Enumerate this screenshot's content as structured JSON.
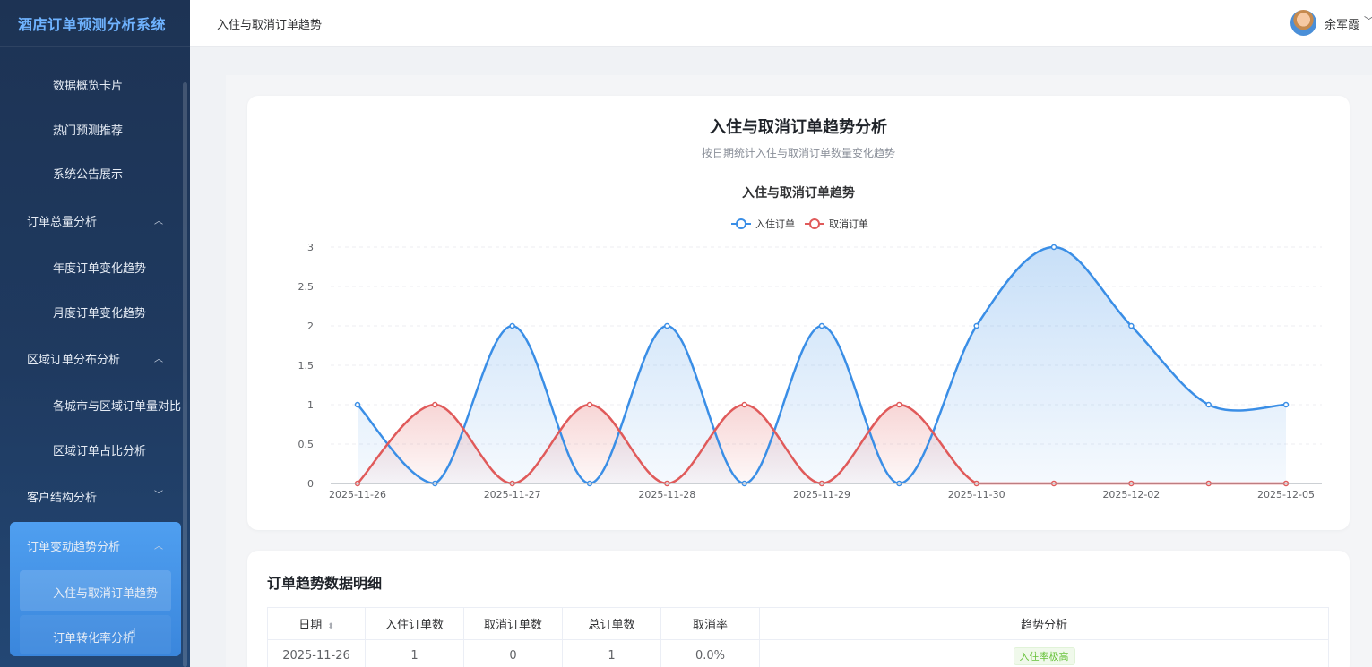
{
  "app": {
    "title": "酒店订单预测分析系统"
  },
  "sidebar": {
    "items": [
      {
        "label": "数据概览卡片",
        "level": "sub"
      },
      {
        "label": "热门预测推荐",
        "level": "sub"
      },
      {
        "label": "系统公告展示",
        "level": "sub"
      },
      {
        "label": "订单总量分析",
        "level": "group",
        "expanded": true
      },
      {
        "label": "年度订单变化趋势",
        "level": "sub"
      },
      {
        "label": "月度订单变化趋势",
        "level": "sub"
      },
      {
        "label": "区域订单分布分析",
        "level": "group",
        "expanded": true
      },
      {
        "label": "各城市与区域订单量对比",
        "level": "sub"
      },
      {
        "label": "区域订单占比分析",
        "level": "sub"
      },
      {
        "label": "客户结构分析",
        "level": "group",
        "expanded": false
      },
      {
        "label": "订单变动趋势分析",
        "level": "group",
        "expanded": true,
        "active": true
      },
      {
        "label": "入住与取消订单趋势",
        "level": "sub",
        "active": true
      },
      {
        "label": "订单转化率分析",
        "level": "sub"
      }
    ]
  },
  "header": {
    "breadcrumb": "入住与取消订单趋势",
    "username": "余军霞"
  },
  "page": {
    "title": "入住与取消订单趋势分析",
    "subtitle": "按日期统计入住与取消订单数量变化趋势"
  },
  "chart_data": {
    "type": "line",
    "title": "入住与取消订单趋势",
    "categories": [
      "2025-11-26",
      "",
      "2025-11-27",
      "",
      "2025-11-28",
      "",
      "2025-11-29",
      "",
      "2025-11-30",
      "",
      "2025-12-02",
      "",
      "2025-12-05"
    ],
    "series": [
      {
        "name": "入住订单",
        "color": "#3a8ee6",
        "values": [
          1,
          0,
          2,
          0,
          2,
          0,
          2,
          0,
          2,
          3,
          2,
          1,
          1
        ]
      },
      {
        "name": "取消订单",
        "color": "#e05a5a",
        "values": [
          0,
          1,
          0,
          1,
          0,
          1,
          0,
          1,
          0,
          0,
          0,
          0,
          0
        ]
      }
    ],
    "ylim": [
      0,
      3
    ],
    "yticks": [
      "0",
      "0.5",
      "1",
      "1.5",
      "2",
      "2.5",
      "3"
    ],
    "smooth": true,
    "area": true,
    "legend": "top-center",
    "grid": true
  },
  "table": {
    "title": "订单趋势数据明细",
    "headers": [
      "日期",
      "入住订单数",
      "取消订单数",
      "总订单数",
      "取消率",
      "趋势分析"
    ],
    "rows": [
      {
        "date": "2025-11-26",
        "checkin": "1",
        "cancel": "0",
        "total": "1",
        "rate": "0.0%",
        "trend": "入住率极高"
      }
    ]
  },
  "colors": {
    "accent": "#3a8ee6",
    "cancel": "#e05a5a",
    "sidebar_bg": "#1f3a60",
    "tag_green": "#67c23a"
  },
  "icons": {
    "sort": "sort-icon",
    "chevron_up": "chevron-up-icon",
    "chevron_down": "chevron-down-icon",
    "cursor": "hand-cursor-icon"
  }
}
